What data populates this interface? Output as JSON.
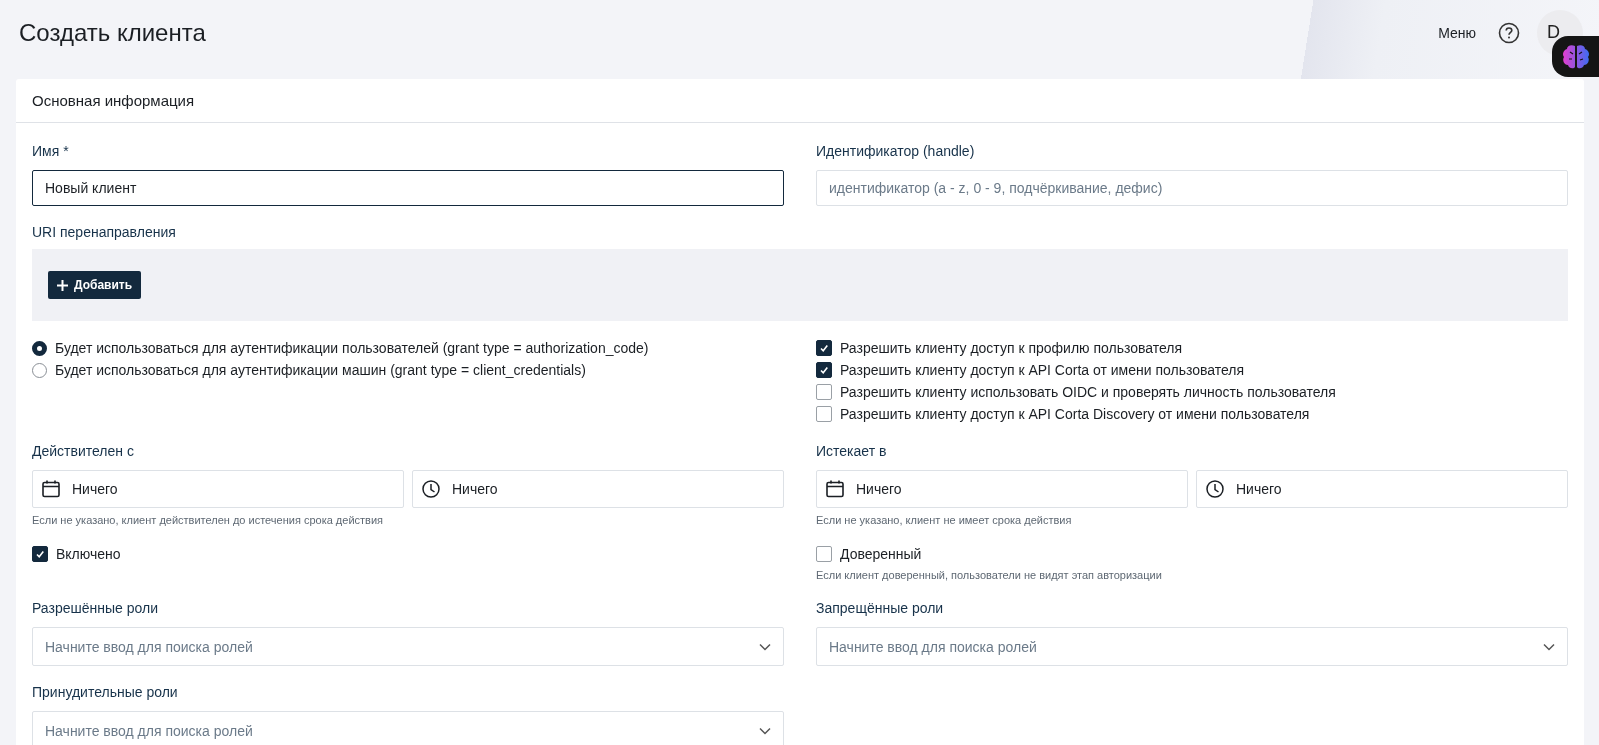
{
  "header": {
    "title": "Создать клиента",
    "menu": "Меню",
    "avatar": "D"
  },
  "card": {
    "title": "Основная информация"
  },
  "name_field": {
    "label": "Имя *",
    "value": "Новый клиент",
    "focused": true
  },
  "handle_field": {
    "label": "Идентификатор (handle)",
    "placeholder": "идентификатор (a - z, 0 - 9, подчёркивание, дефис)"
  },
  "redirect_uris": {
    "label": "URI перенаправления",
    "add_button": "Добавить"
  },
  "grant_types": [
    {
      "label": "Будет использоваться для аутентификации пользователей (grant type = authorization_code)",
      "selected": true
    },
    {
      "label": "Будет использоваться для аутентификации машин (grant type = client_credentials)",
      "selected": false
    }
  ],
  "permissions": [
    {
      "label": "Разрешить клиенту доступ к профилю пользователя",
      "checked": true
    },
    {
      "label": "Разрешить клиенту доступ к API Corta от имени пользователя",
      "checked": true
    },
    {
      "label": "Разрешить клиенту использовать OIDC и проверять личность пользователя",
      "checked": false
    },
    {
      "label": "Разрешить клиенту доступ к API Corta Discovery от имени пользователя",
      "checked": false
    }
  ],
  "valid_from": {
    "label": "Действителен с",
    "date": "Ничего",
    "time": "Ничего",
    "hint": "Если не указано, клиент действителен до истечения срока действия"
  },
  "expires_at": {
    "label": "Истекает в",
    "date": "Ничего",
    "time": "Ничего",
    "hint": "Если не указано, клиент не имеет срока действия"
  },
  "enabled": {
    "label": "Включено",
    "checked": true
  },
  "trusted": {
    "label": "Доверенный",
    "checked": false,
    "hint": "Если клиент доверенный, пользователи не видят этап авторизации"
  },
  "role_fields": [
    {
      "label": "Разрешённые роли",
      "placeholder": "Начните ввод для поиска ролей"
    },
    {
      "label": "Запрещённые роли",
      "placeholder": "Начните ввод для поиска ролей"
    },
    {
      "label": "Принудительные роли",
      "placeholder": "Начните ввод для поиска ролей"
    }
  ]
}
